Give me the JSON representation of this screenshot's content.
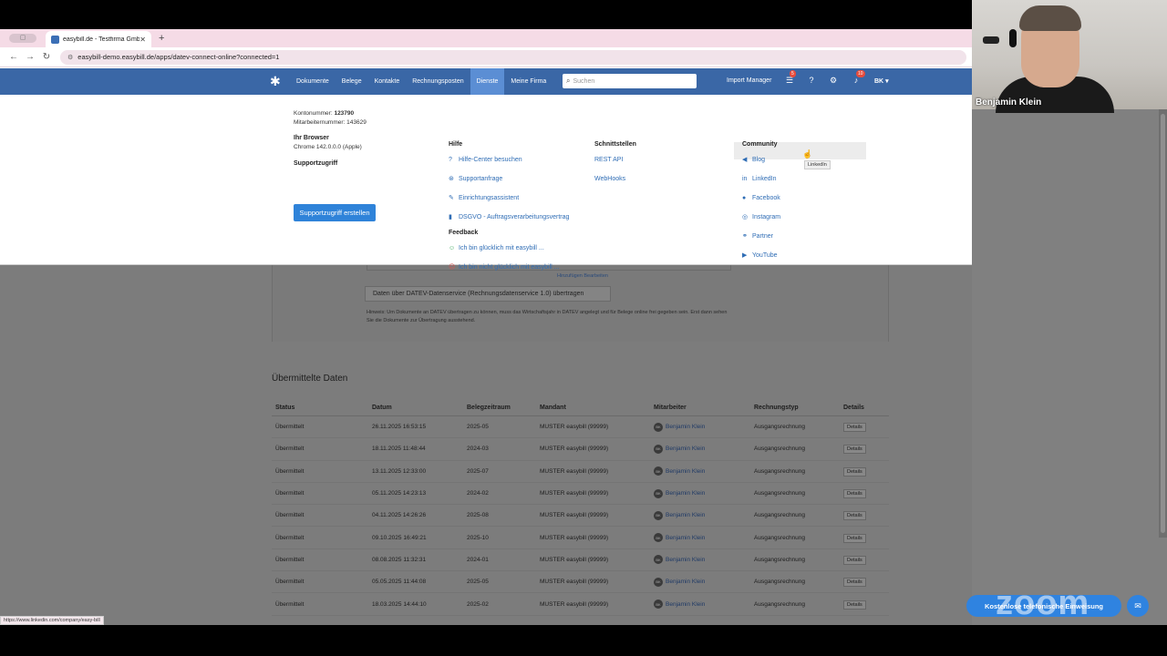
{
  "browser": {
    "tab_title": "easybill.de - Testfirma GmbH",
    "url": "easybill-demo.easybill.de/apps/datev-connect-online?connected=1",
    "status_url": "https://www.linkedin.com/company/easy-bill"
  },
  "nav": {
    "items": [
      "Dokumente",
      "Belege",
      "Kontakte",
      "Rechnungsposten",
      "Dienste",
      "Meine Firma"
    ],
    "active": "Dienste",
    "search_placeholder": "Suchen",
    "import_label": "Import Manager",
    "tasks_badge": "5",
    "notifications_badge": "10",
    "user_initials": "BK"
  },
  "dropdown": {
    "account": {
      "kontonummer_label": "Kontonummer:",
      "kontonummer": "123790",
      "mitarbeiter_label": "Mitarbeiternummer:",
      "mitarbeiter": "143629",
      "browser_title": "Ihr Browser",
      "browser_value": "Chrome 142.0.0.0 (Apple)",
      "support_title": "Supportzugriff",
      "support_button": "Supportzugriff erstellen"
    },
    "hilfe": {
      "title": "Hilfe",
      "links": [
        "Hilfe-Center besuchen",
        "Supportanfrage",
        "Einrichtungsassistent",
        "DSGVO - Auftragsverarbeitungsvertrag"
      ],
      "feedback_title": "Feedback",
      "feedback": [
        "Ich bin glücklich mit easybill ...",
        "Ich bin nicht glücklich mit easybill ..."
      ]
    },
    "schnittstellen": {
      "title": "Schnittstellen",
      "links": [
        "REST API",
        "WebHooks"
      ]
    },
    "community": {
      "title": "Community",
      "links": [
        "Blog",
        "LinkedIn",
        "Facebook",
        "Instagram",
        "Partner",
        "YouTube"
      ],
      "tooltip": "LinkedIn"
    }
  },
  "page": {
    "edit_link": "Hinzufügen Bearbeiten",
    "datev_button": "Daten über DATEV-Datenservice (Rechnungsdatenservice 1.0) übertragen",
    "hint": "Hinweis: Um Dokumente an DATEV übertragen zu können, muss das Wirtschaftsjahr in DATEV angelegt und für Belege online frei gegeben sein. Erst dann sehen Sie die Dokumente zur Übertragung ausstehend.",
    "section_title": "Übermittelte Daten",
    "columns": [
      "Status",
      "Datum",
      "Belegzeitraum",
      "Mandant",
      "Mitarbeiter",
      "Rechnungstyp",
      "Details"
    ],
    "rows": [
      {
        "status": "Übermittelt",
        "datum": "26.11.2025 16:53:15",
        "zeitraum": "2025-05",
        "mandant": "MUSTER easybill (99999)",
        "mitarbeiter": "Benjamin Klein",
        "typ": "Ausgangsrechnung",
        "details": "Details"
      },
      {
        "status": "Übermittelt",
        "datum": "18.11.2025 11:48:44",
        "zeitraum": "2024-03",
        "mandant": "MUSTER easybill (99999)",
        "mitarbeiter": "Benjamin Klein",
        "typ": "Ausgangsrechnung",
        "details": "Details"
      },
      {
        "status": "Übermittelt",
        "datum": "13.11.2025 12:33:00",
        "zeitraum": "2025-07",
        "mandant": "MUSTER easybill (99999)",
        "mitarbeiter": "Benjamin Klein",
        "typ": "Ausgangsrechnung",
        "details": "Details"
      },
      {
        "status": "Übermittelt",
        "datum": "05.11.2025 14:23:13",
        "zeitraum": "2024-02",
        "mandant": "MUSTER easybill (99999)",
        "mitarbeiter": "Benjamin Klein",
        "typ": "Ausgangsrechnung",
        "details": "Details"
      },
      {
        "status": "Übermittelt",
        "datum": "04.11.2025 14:26:26",
        "zeitraum": "2025-08",
        "mandant": "MUSTER easybill (99999)",
        "mitarbeiter": "Benjamin Klein",
        "typ": "Ausgangsrechnung",
        "details": "Details"
      },
      {
        "status": "Übermittelt",
        "datum": "09.10.2025 16:49:21",
        "zeitraum": "2025-10",
        "mandant": "MUSTER easybill (99999)",
        "mitarbeiter": "Benjamin Klein",
        "typ": "Ausgangsrechnung",
        "details": "Details"
      },
      {
        "status": "Übermittelt",
        "datum": "08.08.2025 11:32:31",
        "zeitraum": "2024-01",
        "mandant": "MUSTER easybill (99999)",
        "mitarbeiter": "Benjamin Klein",
        "typ": "Ausgangsrechnung",
        "details": "Details"
      },
      {
        "status": "Übermittelt",
        "datum": "05.05.2025 11:44:08",
        "zeitraum": "2025-05",
        "mandant": "MUSTER easybill (99999)",
        "mitarbeiter": "Benjamin Klein",
        "typ": "Ausgangsrechnung",
        "details": "Details"
      },
      {
        "status": "Übermittelt",
        "datum": "18.03.2025 14:44:10",
        "zeitraum": "2025-02",
        "mandant": "MUSTER easybill (99999)",
        "mitarbeiter": "Benjamin Klein",
        "typ": "Ausgangsrechnung",
        "details": "Details"
      }
    ]
  },
  "webcam": {
    "name": "Benjamin Klein"
  },
  "overlay": {
    "cta": "Kostenlose telefonische Einweisung",
    "zoom": "zoom"
  }
}
